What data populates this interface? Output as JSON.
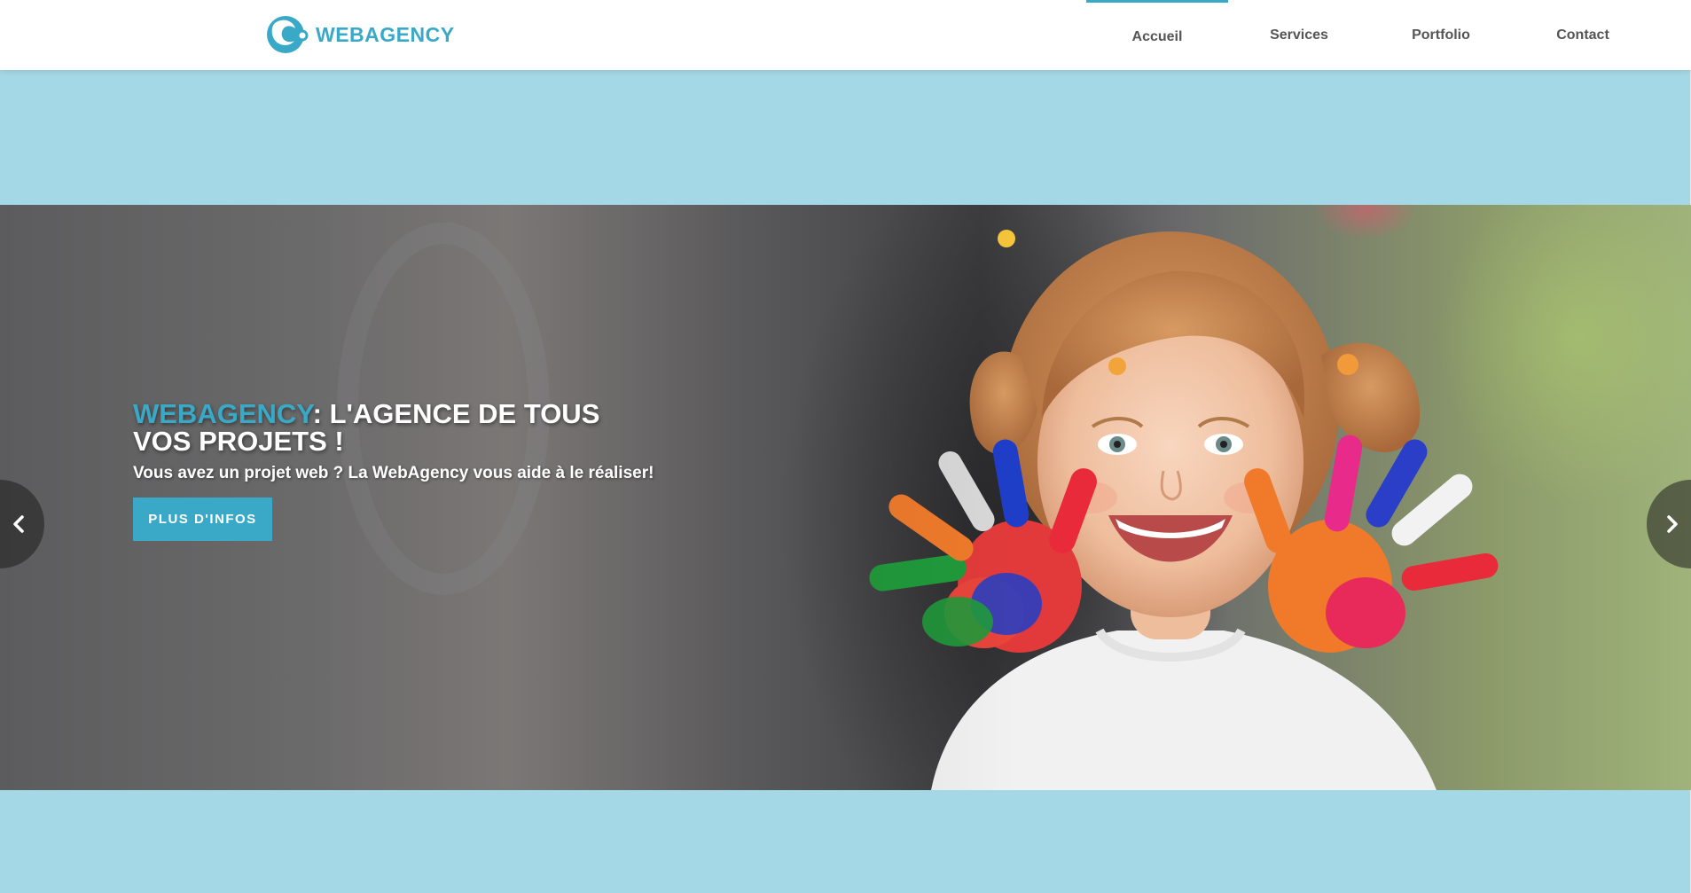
{
  "header": {
    "logo_text": "WEBAGENCY",
    "nav": [
      {
        "label": "Accueil",
        "active": true
      },
      {
        "label": "Services",
        "active": false
      },
      {
        "label": "Portfolio",
        "active": false
      },
      {
        "label": "Contact",
        "active": false
      }
    ]
  },
  "hero": {
    "title_brand": "WEBAGENCY",
    "title_rest_line1": ": L'AGENCE DE TOUS",
    "title_rest_line2": "VOS PROJETS !",
    "subtitle": "Vous avez un projet web ? La WebAgency vous aide à le réaliser!",
    "button_label": "PLUS D'INFOS",
    "prev_icon": "chevron-left-icon",
    "next_icon": "chevron-right-icon",
    "image_description": ""
  },
  "colors": {
    "accent": "#3aa9c7",
    "page_background": "#a5d8e6",
    "header_background": "#ffffff",
    "nav_text": "#555555"
  }
}
